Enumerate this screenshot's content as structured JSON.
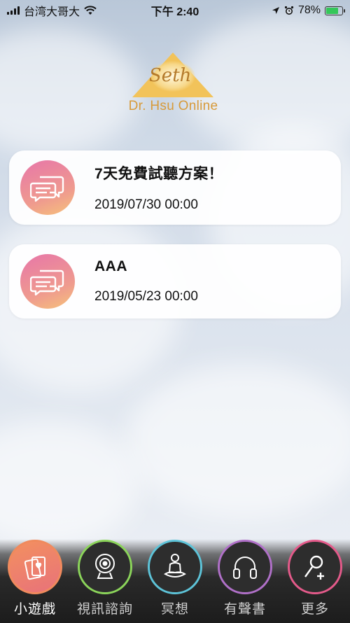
{
  "status_bar": {
    "carrier": "台湾大哥大",
    "time": "下午 2:40",
    "battery": "78%",
    "battery_level": 0.78
  },
  "logo": {
    "script_text": "Seth",
    "name": "Dr. Hsu Online"
  },
  "messages": [
    {
      "title": "7天免費試聽方案！",
      "date": "2019/07/30 00:00",
      "icon": "chat-bubbles-icon"
    },
    {
      "title": "AAA",
      "date": "2019/05/23 00:00",
      "icon": "chat-bubbles-icon"
    }
  ],
  "tabs": [
    {
      "label": "小遊戲",
      "icon": "cards-icon",
      "ring": "#f08a5d",
      "active": true
    },
    {
      "label": "視訊諮詢",
      "icon": "webcam-icon",
      "ring": "#8bd45a",
      "active": false
    },
    {
      "label": "冥想",
      "icon": "meditation-icon",
      "ring": "#5dc3d8",
      "active": false
    },
    {
      "label": "有聲書",
      "icon": "headphones-icon",
      "ring": "#b070c8",
      "active": false
    },
    {
      "label": "更多",
      "icon": "add-user-icon",
      "ring": "#e45a8a",
      "active": false
    }
  ],
  "colors": {
    "card_icon_gradient": [
      "#e776a9",
      "#f6c27a"
    ],
    "tabbar": "#1c1c1c"
  }
}
